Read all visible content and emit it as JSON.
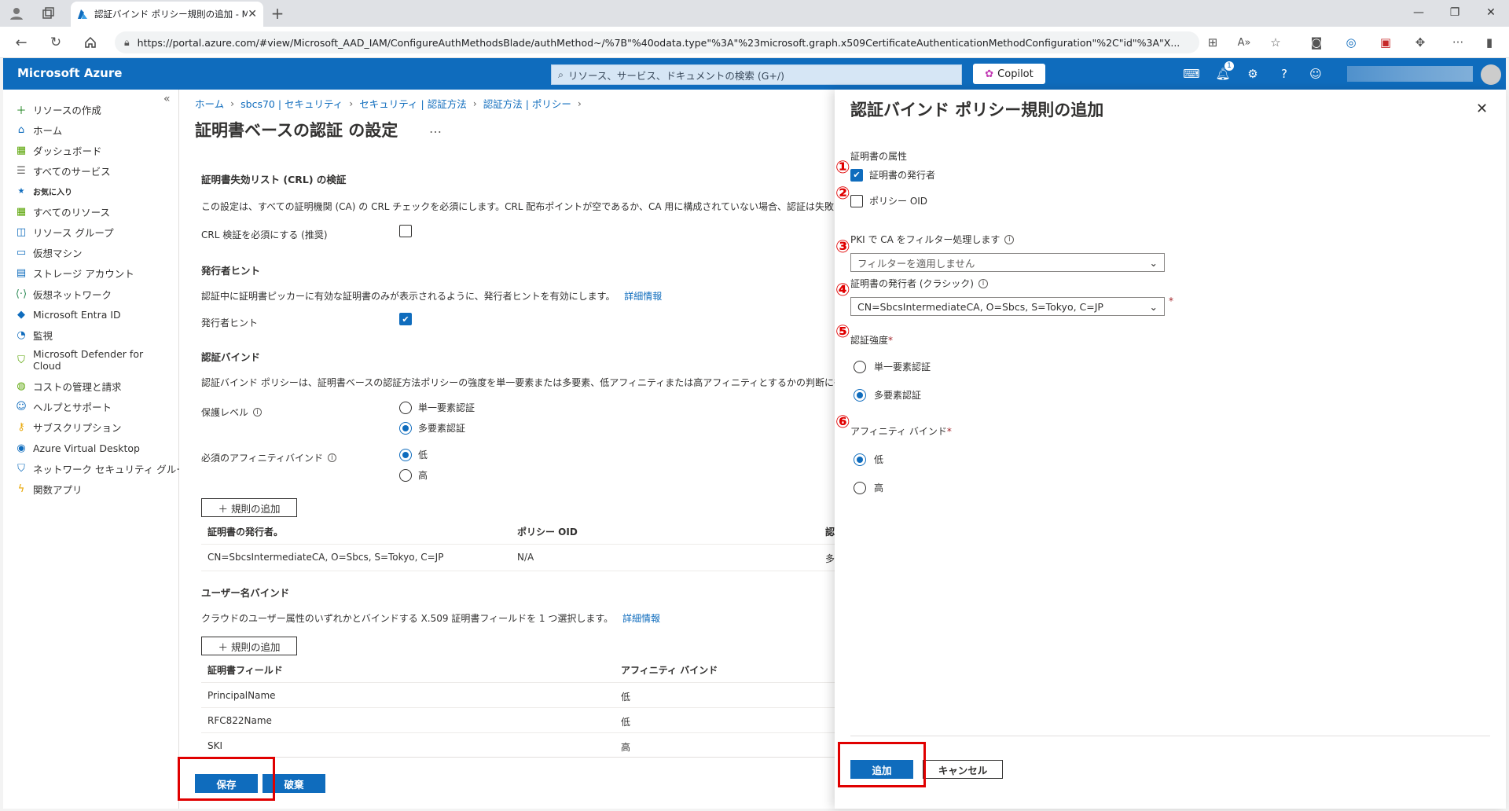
{
  "browser": {
    "tab_title": "認証バインド ポリシー規則の追加 - M",
    "url": "https://portal.azure.com/#view/Microsoft_AAD_IAM/ConfigureAuthMethodsBlade/authMethod~/%7B\"%40odata.type\"%3A\"%23microsoft.graph.x509CertificateAuthenticationMethodConfiguration\"%2C\"id\"%3A\"X..."
  },
  "azure": {
    "brand": "Microsoft Azure",
    "search_placeholder": "リソース、サービス、ドキュメントの検索 (G+/)",
    "copilot_label": "Copilot",
    "notification_count": "1"
  },
  "nav": {
    "items": [
      {
        "label": "リソースの作成",
        "icon": "plus-icon"
      },
      {
        "label": "ホーム",
        "icon": "home-icon"
      },
      {
        "label": "ダッシュボード",
        "icon": "dashboard-icon"
      },
      {
        "label": "すべてのサービス",
        "icon": "list-icon"
      },
      {
        "label": "お気に入り",
        "icon": "star-icon"
      },
      {
        "label": "すべてのリソース",
        "icon": "grid-icon"
      },
      {
        "label": "リソース グループ",
        "icon": "resource-group-icon"
      },
      {
        "label": "仮想マシン",
        "icon": "vm-icon"
      },
      {
        "label": "ストレージ アカウント",
        "icon": "storage-icon"
      },
      {
        "label": "仮想ネットワーク",
        "icon": "vnet-icon"
      },
      {
        "label": "Microsoft Entra ID",
        "icon": "entra-icon"
      },
      {
        "label": "監視",
        "icon": "monitor-icon"
      },
      {
        "label": "Microsoft Defender for Cloud",
        "icon": "defender-icon"
      },
      {
        "label": "コストの管理と請求",
        "icon": "cost-icon"
      },
      {
        "label": "ヘルプとサポート",
        "icon": "help-support-icon"
      },
      {
        "label": "サブスクリプション",
        "icon": "key-icon"
      },
      {
        "label": "Azure Virtual Desktop",
        "icon": "avd-icon"
      },
      {
        "label": "ネットワーク セキュリティ グループ",
        "icon": "nsg-icon"
      },
      {
        "label": "関数アプリ",
        "icon": "function-icon"
      }
    ]
  },
  "breadcrumb": [
    "ホーム",
    "sbcs70 | セキュリティ",
    "セキュリティ | 認証方法",
    "認証方法 | ポリシー"
  ],
  "main": {
    "title": "証明書ベースの認証 の設定",
    "more": "…",
    "crl_heading": "証明書失効リスト (CRL) の検証",
    "crl_desc": "この設定は、すべての証明機関 (CA) の CRL チェックを必須にします。CRL 配布ポイントが空であるか、CA 用に構成されていない場合、認証は失敗します。詳",
    "crl_checkbox_label": "CRL 検証を必須にする (推奨)",
    "issuer_hint_heading": "発行者ヒント",
    "issuer_hint_desc": "認証中に証明書ピッカーに有効な証明書のみが表示されるように、発行者ヒントを有効にします。",
    "issuer_hint_link": "詳細情報",
    "issuer_hint_label": "発行者ヒント",
    "binding_heading": "認証バインド",
    "binding_desc": "認証バインド ポリシーは、証明書ベースの認証方法ポリシーの強度を単一要素または多要素、低アフィニティまたは高アフィニティとするかの判断に役立ちます。",
    "protection_label": "保護レベル",
    "protection_options": [
      "単一要素認証",
      "多要素認証"
    ],
    "affinity_label": "必須のアフィニティバインド",
    "affinity_options": [
      "低",
      "高"
    ],
    "add_rule_label": "規則の追加",
    "rules_table": {
      "headers": [
        "証明書の発行者。",
        "ポリシー OID",
        "認"
      ],
      "rows": [
        [
          "CN=SbcsIntermediateCA, O=Sbcs, S=Tokyo, C=JP",
          "N/A",
          "多"
        ]
      ]
    },
    "username_heading": "ユーザー名バインド",
    "username_desc": "クラウドのユーザー属性のいずれかとバインドする X.509 証明書フィールドを 1 つ選択します。",
    "username_link": "詳細情報",
    "username_table": {
      "headers": [
        "証明書フィールド",
        "アフィニティ バインド"
      ],
      "rows": [
        [
          "PrincipalName",
          "低"
        ],
        [
          "RFC822Name",
          "低"
        ],
        [
          "SKI",
          "高"
        ]
      ]
    },
    "save_label": "保存",
    "discard_label": "破棄"
  },
  "panel": {
    "title": "認証バインド ポリシー規則の追加",
    "cert_attr_label": "証明書の属性",
    "issuer_label": "証明書の発行者",
    "policy_oid_label": "ポリシー OID",
    "pki_label": "PKI で CA をフィルター処理します",
    "pki_value": "フィルターを適用しません",
    "classic_label": "証明書の発行者 (クラシック)",
    "classic_value": "CN=SbcsIntermediateCA, O=Sbcs, S=Tokyo, C=JP",
    "strength_label": "認証強度",
    "strength_options": [
      "単一要素認証",
      "多要素認証"
    ],
    "affinity_label": "アフィニティ バインド",
    "affinity_options": [
      "低",
      "高"
    ],
    "required_mark": "*",
    "add_label": "追加",
    "cancel_label": "キャンセル"
  },
  "markers": [
    "①",
    "②",
    "③",
    "④",
    "⑤",
    "⑥"
  ],
  "colors": {
    "accent": "#0f6cbd",
    "highlight": "#e00000"
  }
}
